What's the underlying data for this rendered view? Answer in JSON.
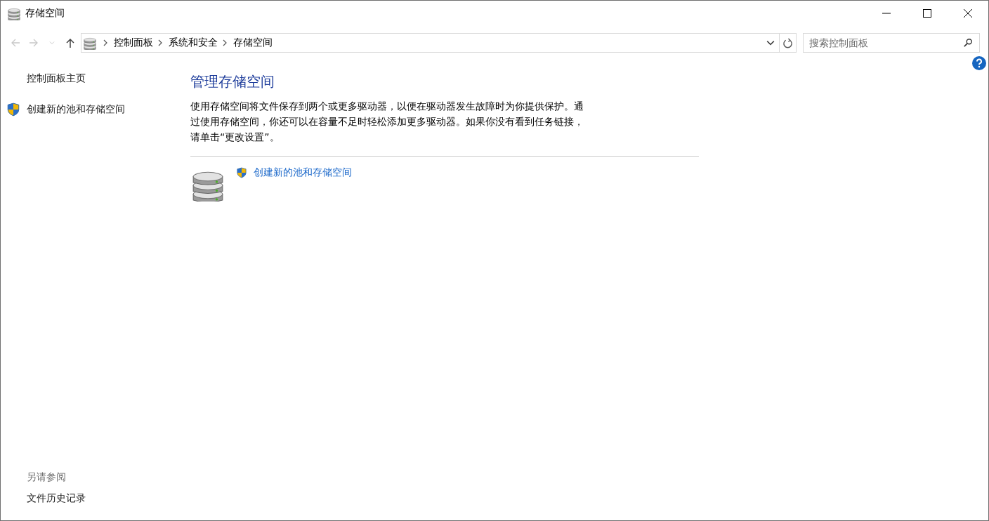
{
  "window": {
    "title": "存储空间"
  },
  "nav": [
    {
      "kind": "back",
      "disabled": true
    },
    {
      "kind": "forward",
      "disabled": true
    },
    {
      "kind": "recent",
      "disabled": true
    },
    {
      "kind": "up",
      "disabled": false
    }
  ],
  "breadcrumb": [
    "控制面板",
    "系统和安全",
    "存储空间"
  ],
  "search": {
    "placeholder": "搜索控制面板"
  },
  "sidebar": {
    "items": [
      {
        "label": "控制面板主页",
        "shield": false
      },
      {
        "label": "创建新的池和存储空间",
        "shield": true
      }
    ],
    "see_also": {
      "heading": "另请参阅",
      "items": [
        "文件历史记录"
      ]
    }
  },
  "main": {
    "heading": "管理存储空间",
    "description": "使用存储空间将文件保存到两个或更多驱动器，以便在驱动器发生故障时为你提供保护。通过使用存储空间，你还可以在容量不足时轻松添加更多驱动器。如果你没有看到任务链接，请单击“更改设置”。",
    "tasks": [
      {
        "label": "创建新的池和存储空间",
        "shield": true
      }
    ]
  }
}
